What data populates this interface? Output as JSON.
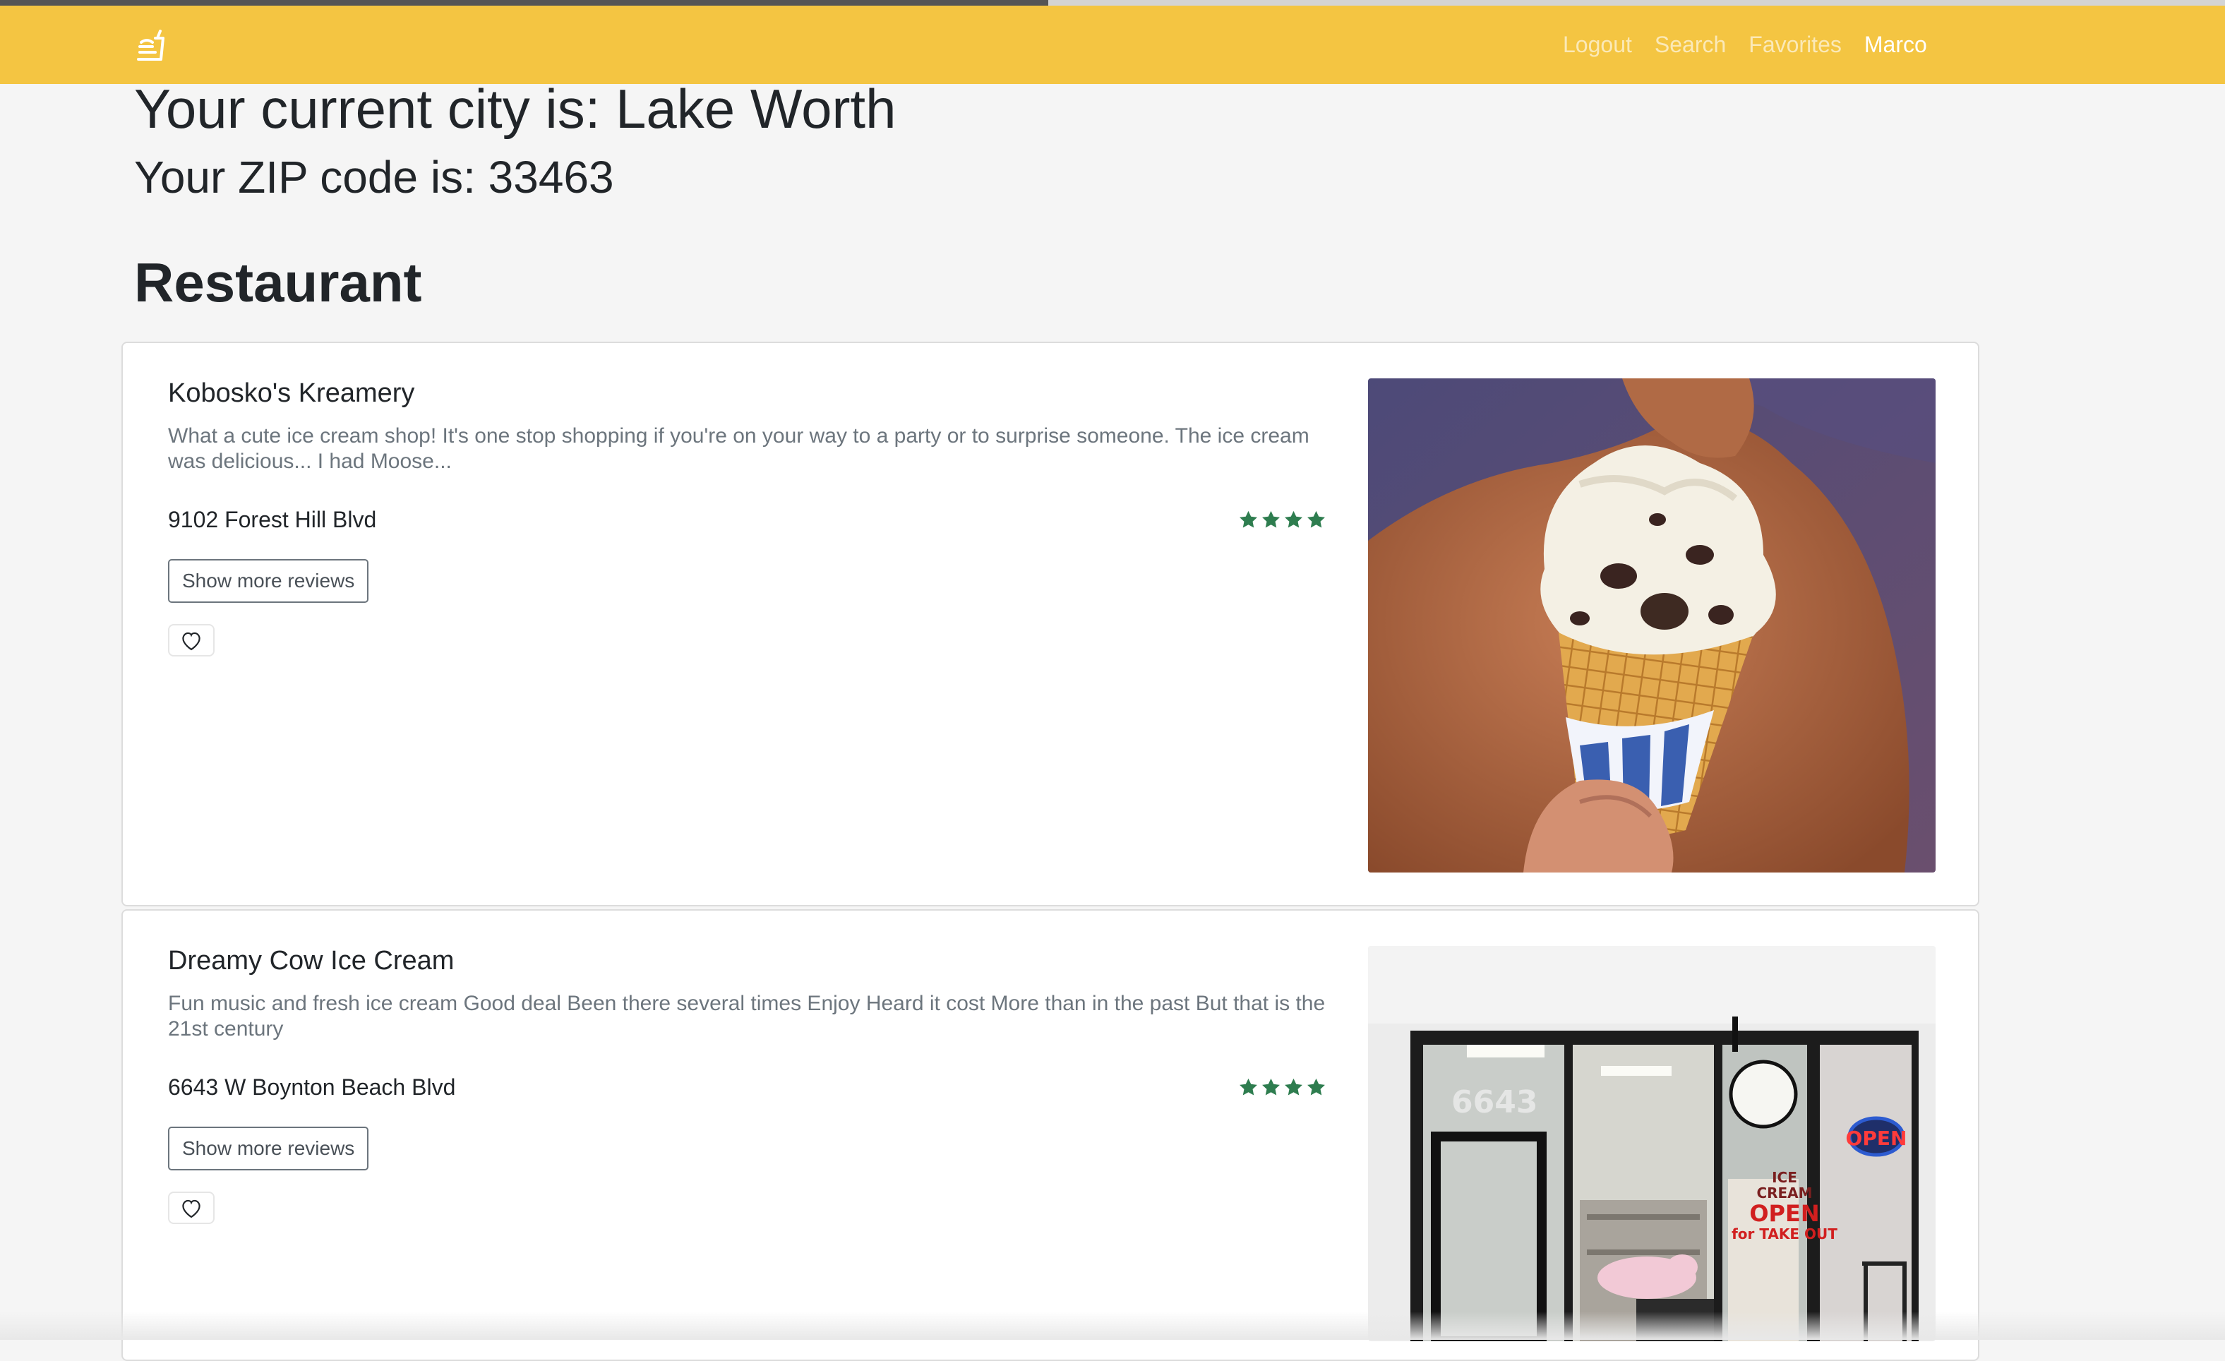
{
  "nav": {
    "links": [
      "Logout",
      "Search",
      "Favorites"
    ],
    "user": "Marco"
  },
  "location": {
    "city_text": "Your current city is: Lake Worth",
    "zip_text": "Your ZIP code is: 33463"
  },
  "section_title": "Restaurant",
  "restaurants": [
    {
      "name": "Kobosko's Kreamery",
      "review": "What a cute ice cream shop! It's one stop shopping if you're on your way to a party or to surprise someone. The ice cream was delicious... I had Moose...",
      "address": "9102 Forest Hill Blvd",
      "rating": 4,
      "button_label": "Show more reviews",
      "favorite_icon": "heart-outline-icon"
    },
    {
      "name": "Dreamy Cow Ice Cream",
      "review": "Fun music and fresh ice cream Good deal Been there several times Enjoy Heard it cost More than in the past But that is the 21st century",
      "address": "6643 W Boynton Beach Blvd",
      "rating": 4,
      "button_label": "Show more reviews",
      "favorite_icon": "heart-outline-icon",
      "photo_signage": {
        "store_number": "6643",
        "open_sign": "OPEN",
        "window_text": [
          "ICE",
          "CREAM",
          "OPEN",
          "for TAKE OUT"
        ]
      }
    }
  ],
  "colors": {
    "navbar": "#f4c542",
    "star": "#2e7d4f",
    "page_bg": "#f5f5f5"
  }
}
